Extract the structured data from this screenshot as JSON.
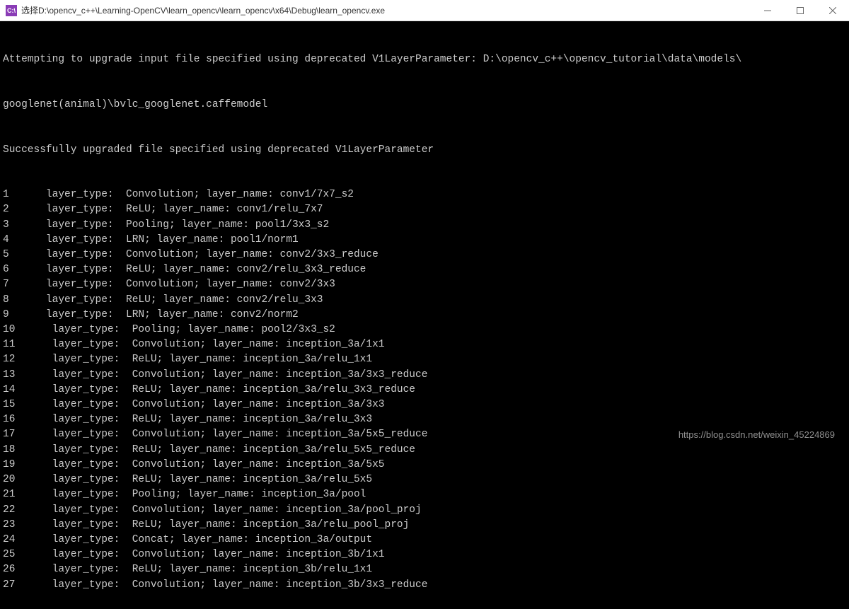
{
  "titlebar": {
    "icon_text": "C:\\",
    "title": "选择D:\\opencv_c++\\Learning-OpenCV\\learn_opencv\\learn_opencv\\x64\\Debug\\learn_opencv.exe"
  },
  "console": {
    "header_lines": [
      "Attempting to upgrade input file specified using deprecated V1LayerParameter: D:\\opencv_c++\\opencv_tutorial\\data\\models\\",
      "googlenet(animal)\\bvlc_googlenet.caffemodel",
      "Successfully upgraded file specified using deprecated V1LayerParameter"
    ],
    "layers": [
      {
        "n": "1",
        "type": "Convolution",
        "name": "conv1/7x7_s2",
        "pad": " "
      },
      {
        "n": "2",
        "type": "ReLU",
        "name": "conv1/relu_7x7",
        "pad": " "
      },
      {
        "n": "3",
        "type": "Pooling",
        "name": "pool1/3x3_s2",
        "pad": " "
      },
      {
        "n": "4",
        "type": "LRN",
        "name": "pool1/norm1",
        "pad": " "
      },
      {
        "n": "5",
        "type": "Convolution",
        "name": "conv2/3x3_reduce",
        "pad": " "
      },
      {
        "n": "6",
        "type": "ReLU",
        "name": "conv2/relu_3x3_reduce",
        "pad": " "
      },
      {
        "n": "7",
        "type": "Convolution",
        "name": "conv2/3x3",
        "pad": " "
      },
      {
        "n": "8",
        "type": "ReLU",
        "name": "conv2/relu_3x3",
        "pad": " "
      },
      {
        "n": "9",
        "type": "LRN",
        "name": "conv2/norm2",
        "pad": " "
      },
      {
        "n": "10",
        "type": "Pooling",
        "name": "pool2/3x3_s2",
        "pad": "  "
      },
      {
        "n": "11",
        "type": "Convolution",
        "name": "inception_3a/1x1",
        "pad": "  "
      },
      {
        "n": "12",
        "type": "ReLU",
        "name": "inception_3a/relu_1x1",
        "pad": "  "
      },
      {
        "n": "13",
        "type": "Convolution",
        "name": "inception_3a/3x3_reduce",
        "pad": "  "
      },
      {
        "n": "14",
        "type": "ReLU",
        "name": "inception_3a/relu_3x3_reduce",
        "pad": "  "
      },
      {
        "n": "15",
        "type": "Convolution",
        "name": "inception_3a/3x3",
        "pad": "  "
      },
      {
        "n": "16",
        "type": "ReLU",
        "name": "inception_3a/relu_3x3",
        "pad": "  "
      },
      {
        "n": "17",
        "type": "Convolution",
        "name": "inception_3a/5x5_reduce",
        "pad": "  "
      },
      {
        "n": "18",
        "type": "ReLU",
        "name": "inception_3a/relu_5x5_reduce",
        "pad": "  "
      },
      {
        "n": "19",
        "type": "Convolution",
        "name": "inception_3a/5x5",
        "pad": "  "
      },
      {
        "n": "20",
        "type": "ReLU",
        "name": "inception_3a/relu_5x5",
        "pad": "  "
      },
      {
        "n": "21",
        "type": "Pooling",
        "name": "inception_3a/pool",
        "pad": "  "
      },
      {
        "n": "22",
        "type": "Convolution",
        "name": "inception_3a/pool_proj",
        "pad": "  "
      },
      {
        "n": "23",
        "type": "ReLU",
        "name": "inception_3a/relu_pool_proj",
        "pad": "  "
      },
      {
        "n": "24",
        "type": "Concat",
        "name": "inception_3a/output",
        "pad": "  "
      },
      {
        "n": "25",
        "type": "Convolution",
        "name": "inception_3b/1x1",
        "pad": "  "
      },
      {
        "n": "26",
        "type": "ReLU",
        "name": "inception_3b/relu_1x1",
        "pad": "  "
      },
      {
        "n": "27",
        "type": "Convolution",
        "name": "inception_3b/3x3_reduce",
        "pad": "  "
      }
    ]
  },
  "watermark": "https://blog.csdn.net/weixin_45224869"
}
